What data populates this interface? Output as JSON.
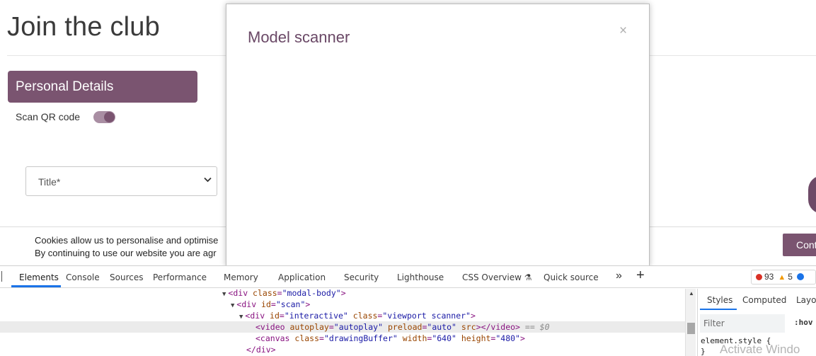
{
  "page": {
    "title": "Join the club",
    "section_header": "Personal Details",
    "scan_label": "Scan QR code",
    "scan_toggle_on": true,
    "title_select": "Title*",
    "cookie_line1": "Cookies allow us to personalise and optimise",
    "cookie_line2": "By continuing to use our website you are agr",
    "cookie_button": "Cont"
  },
  "modal": {
    "title": "Model scanner",
    "close_glyph": "×"
  },
  "devtools": {
    "tabs": [
      "Elements",
      "Console",
      "Sources",
      "Performance",
      "Memory",
      "Application",
      "Security",
      "Lighthouse",
      "CSS Overview",
      "Quick source"
    ],
    "active_tab": "Elements",
    "css_overview_flask": "⚗",
    "overflow_glyph": "»",
    "plus_glyph": "+",
    "errors": "93",
    "warnings": "5",
    "code": {
      "l1_tag": "<div ",
      "l1_attr": "class",
      "l1_val": "\"modal-body\"",
      "l1_end": ">",
      "l2_tag": "<div ",
      "l2_attr": "id",
      "l2_val": "\"scan\"",
      "l2_end": ">",
      "l3_tag": "<div ",
      "l3_attr1": "id",
      "l3_val1": "\"interactive\"",
      "l3_attr2": "class",
      "l3_val2": "\"viewport scanner\"",
      "l3_end": ">",
      "l4_tag": "<video ",
      "l4_attr1": "autoplay",
      "l4_val1": "\"autoplay\"",
      "l4_attr2": "preload",
      "l4_val2": "\"auto\"",
      "l4_attr3": "src",
      "l4_end": "></video>",
      "l4_marker": "== $0",
      "l5_tag": "<canvas ",
      "l5_attr1": "class",
      "l5_val1": "\"drawingBuffer\"",
      "l5_attr2": "width",
      "l5_val2": "\"640\"",
      "l5_attr3": "height",
      "l5_val3": "\"480\"",
      "l5_end": ">",
      "l6": "</div>"
    },
    "styles": {
      "tabs": [
        "Styles",
        "Computed",
        "Layou"
      ],
      "filter_placeholder": "Filter",
      "hov": ":hov",
      "element_style": "element.style {",
      "element_style_close": "}"
    }
  },
  "watermark": "Activate Windo"
}
